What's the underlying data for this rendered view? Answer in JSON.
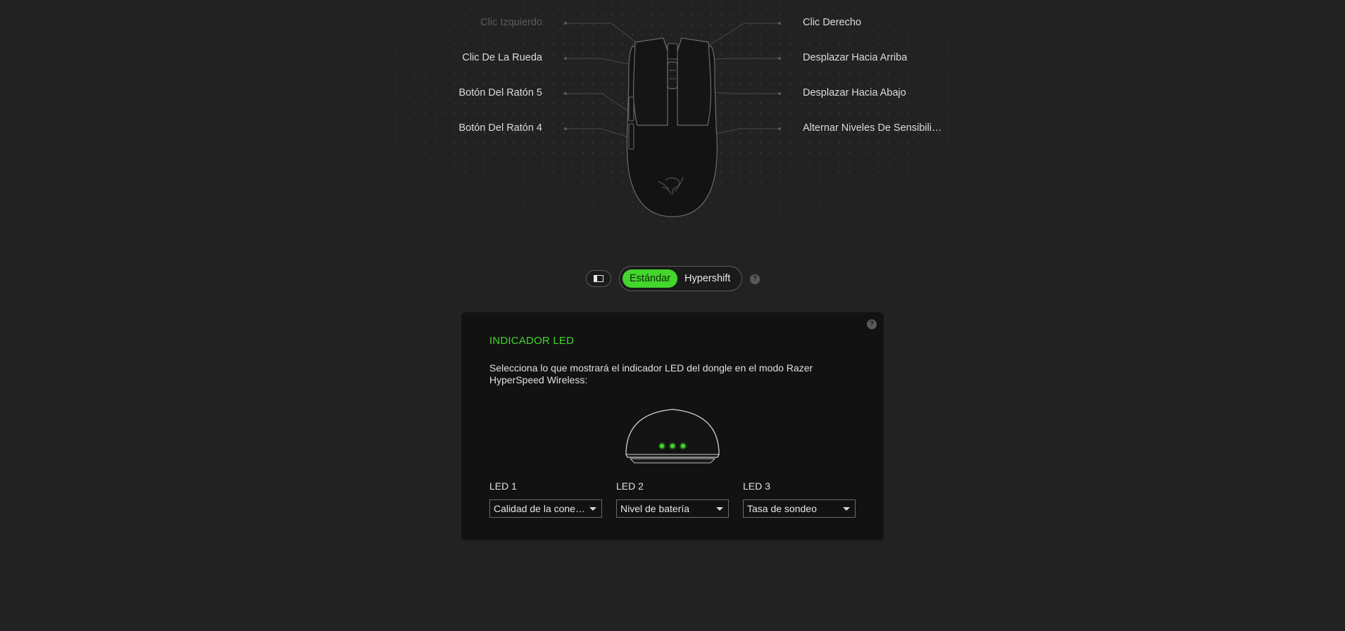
{
  "mouse": {
    "buttons_left": [
      {
        "label": "Clic Izquierdo",
        "faded": true
      },
      {
        "label": "Clic De La Rueda",
        "faded": false
      },
      {
        "label": "Botón Del Ratón 5",
        "faded": false
      },
      {
        "label": "Botón Del Ratón 4",
        "faded": false
      }
    ],
    "buttons_right": [
      {
        "label": "Clic Derecho"
      },
      {
        "label": "Desplazar Hacia Arriba"
      },
      {
        "label": "Desplazar Hacia Abajo"
      },
      {
        "label": "Alternar Niveles De Sensibilidad"
      }
    ],
    "logo_icon": "razer-snake-icon"
  },
  "mode": {
    "panel_toggle_icon": "sidebar-panel-icon",
    "options": [
      "Estándar",
      "Hypershift"
    ],
    "active": "Estándar",
    "help_icon": "question-icon",
    "help_symbol": "?"
  },
  "led_card": {
    "title": "INDICADOR LED",
    "description": "Selecciona lo que mostrará el indicador LED del dongle en el modo Razer HyperSpeed Wireless:",
    "help_symbol": "?",
    "dongle_icon": "dongle-icon",
    "leds": [
      {
        "label": "LED 1",
        "value": "Calidad de la conexión"
      },
      {
        "label": "LED 2",
        "value": "Nivel de batería"
      },
      {
        "label": "LED 3",
        "value": "Tasa de sondeo"
      }
    ]
  },
  "colors": {
    "accent": "#44d62c",
    "background": "#222222",
    "card": "#121212"
  }
}
